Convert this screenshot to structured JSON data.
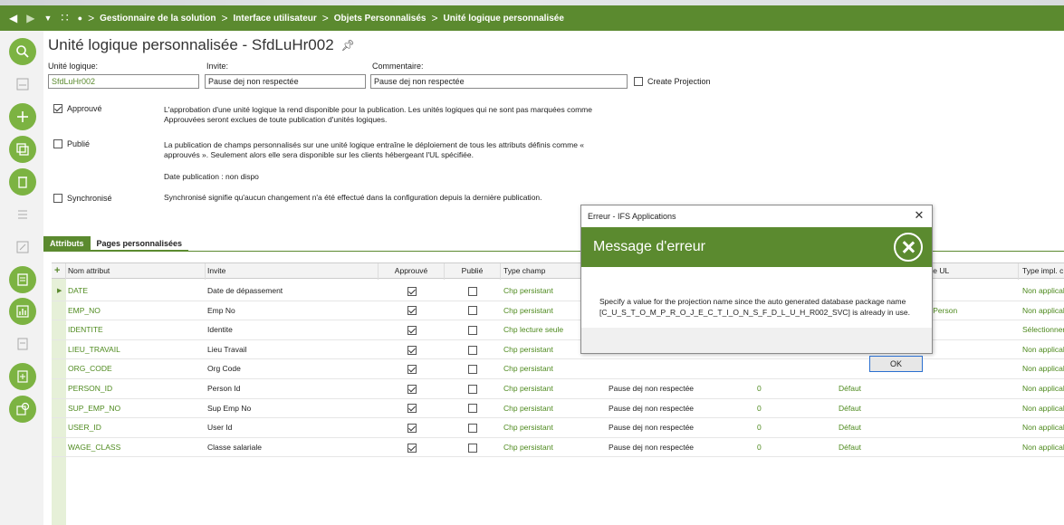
{
  "breadcrumb": [
    "Gestionnaire de la solution",
    "Interface utilisateur",
    "Objets Personnalisés",
    "Unité logique personnalisée"
  ],
  "page_title": "Unité logique personnalisée - SfdLuHr002",
  "form": {
    "unit_label": "Unité logique:",
    "unit_value": "SfdLuHr002",
    "prompt_label": "Invite:",
    "prompt_value": "Pause dej non respectée",
    "comment_label": "Commentaire:",
    "comment_value": "Pause dej non respectée",
    "create_projection_label": "Create Projection",
    "approved_label": "Approuvé",
    "approved_desc": "L'approbation d'une unité logique la rend disponible pour la publication. Les unités logiques qui ne sont pas marquées comme Approuvées seront exclues de toute publication d'unités logiques.",
    "published_label": "Publié",
    "published_desc": "La publication de champs personnalisés sur une unité logique entraîne le déploiement de tous les attributs définis comme « approuvés ». Seulement alors elle sera disponible sur les clients hébergeant l'UL spécifiée.",
    "publish_date": "Date publication : non dispo",
    "sync_label": "Synchronisé",
    "sync_desc": "Synchronisé signifie qu'aucun changement n'a été effectué dans la configuration depuis la dernière publication."
  },
  "tabs": [
    "Attributs",
    "Pages personnalisées"
  ],
  "table": {
    "headers": [
      "Nom attribut",
      "Invite",
      "Approuvé",
      "Publié",
      "Type champ",
      "",
      "",
      "",
      "ce UL",
      "Type impl. c"
    ],
    "rows": [
      {
        "name": "DATE",
        "prompt": "Date de dépassement",
        "type": "Chp persistant",
        "p2": "",
        "z": "",
        "def": "",
        "ul": "",
        "impl": "Non applical"
      },
      {
        "name": "EMP_NO",
        "prompt": "Emp No",
        "type": "Chp persistant",
        "p2": "",
        "z": "",
        "def": "",
        "ul": "yPerson",
        "impl": "Non applical"
      },
      {
        "name": "IDENTITE",
        "prompt": "Identite",
        "type": "Chp lecture seule",
        "p2": "",
        "z": "",
        "def": "",
        "ul": "",
        "impl": "Sélectionner"
      },
      {
        "name": "LIEU_TRAVAIL",
        "prompt": "Lieu Travail",
        "type": "Chp persistant",
        "p2": "",
        "z": "",
        "def": "",
        "ul": "",
        "impl": "Non applical"
      },
      {
        "name": "ORG_CODE",
        "prompt": "Org Code",
        "type": "Chp persistant",
        "p2": "",
        "z": "",
        "def": "",
        "ul": "",
        "impl": "Non applical"
      },
      {
        "name": "PERSON_ID",
        "prompt": "Person Id",
        "type": "Chp persistant",
        "p2": "Pause dej non respectée",
        "z": "0",
        "def": "Défaut",
        "ul": "",
        "impl": "Non applical"
      },
      {
        "name": "SUP_EMP_NO",
        "prompt": "Sup Emp No",
        "type": "Chp persistant",
        "p2": "Pause dej non respectée",
        "z": "0",
        "def": "Défaut",
        "ul": "",
        "impl": "Non applical"
      },
      {
        "name": "USER_ID",
        "prompt": "User Id",
        "type": "Chp persistant",
        "p2": "Pause dej non respectée",
        "z": "0",
        "def": "Défaut",
        "ul": "",
        "impl": "Non applical"
      },
      {
        "name": "WAGE_CLASS",
        "prompt": "Classe salariale",
        "type": "Chp persistant",
        "p2": "Pause dej non respectée",
        "z": "0",
        "def": "Défaut",
        "ul": "",
        "impl": "Non applical"
      }
    ]
  },
  "dialog": {
    "window_title": "Erreur - IFS Applications",
    "header": "Message d'erreur",
    "message": "Specify a value for the projection name since the auto generated database package name [C_U_S_T_O_M_P_R_O_J_E_C_T_I_O_N_S_F_D_L_U_H_R002_SVC] is already in use.",
    "ok_label": "OK"
  },
  "colors": {
    "accent": "#5b8a2f",
    "green_text": "#4e8a1e"
  }
}
